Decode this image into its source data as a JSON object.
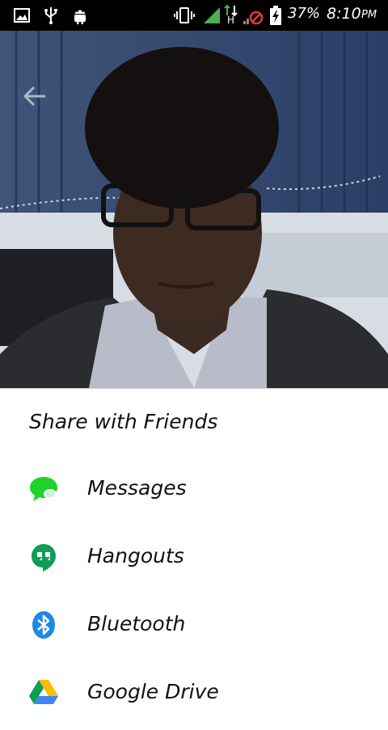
{
  "status_bar": {
    "battery": "37%",
    "time": "8:10",
    "ampm": "PM",
    "network": "H",
    "icons": [
      "gallery-icon",
      "usb-icon",
      "android-debug-icon",
      "vibrate-icon",
      "signal-icon",
      "data-arrows-icon",
      "no-signal-icon",
      "battery-charging-icon"
    ]
  },
  "photo": {
    "back_icon": "arrow-back-icon"
  },
  "share_sheet": {
    "title": "Share with Friends",
    "items": [
      {
        "label": "Messages",
        "icon": "messages-icon",
        "color": "#1fd32c"
      },
      {
        "label": "Hangouts",
        "icon": "hangouts-icon",
        "color": "#0f9d58"
      },
      {
        "label": "Bluetooth",
        "icon": "bluetooth-icon",
        "color": "#1e88e5"
      },
      {
        "label": "Google Drive",
        "icon": "drive-icon",
        "color": "#fbbc04"
      }
    ]
  }
}
